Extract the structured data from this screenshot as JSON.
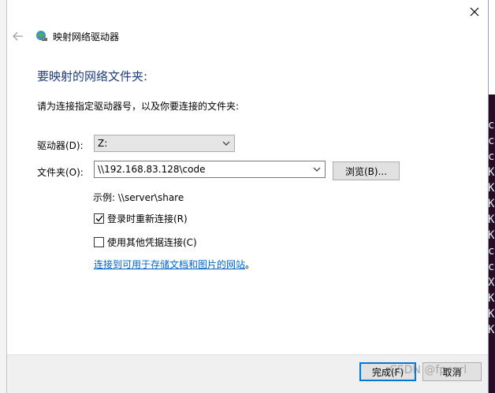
{
  "window": {
    "title": "映射网络驱动器"
  },
  "main": {
    "heading": "要映射的网络文件夹:",
    "instruction": "请为连接指定驱动器号，以及你要连接的文件夹:",
    "drive_label": "驱动器(D):",
    "drive_value": "Z:",
    "folder_label": "文件夹(O):",
    "folder_value": "\\\\192.168.83.128\\code",
    "browse_label": "浏览(B)...",
    "example_text": "示例: \\\\server\\share",
    "reconnect_label": "登录时重新连接(R)",
    "reconnect_checked": true,
    "other_credentials_label": "使用其他凭据连接(C)",
    "other_credentials_checked": false,
    "link_text": "连接到可用于存储文档和图片的网站",
    "link_suffix": "。"
  },
  "footer": {
    "finish_label": "完成(F)",
    "cancel_label": "取消"
  },
  "watermark": "CSDN @fpcarl",
  "background_terminal": [
    "c",
    "c",
    "c",
    "K",
    "K",
    "K",
    "K",
    "K",
    "c",
    "c",
    "X",
    "K",
    "K",
    "K"
  ],
  "colors": {
    "heading": "#1e3d7b",
    "link": "#0066cc",
    "focus": "#0078d7",
    "terminal_bg": "#2b0b22"
  },
  "icons": {
    "close": "close-icon",
    "back": "back-arrow-icon",
    "network_drive": "network-drive-icon",
    "dropdown": "chevron-down-icon",
    "check": "checkmark-icon"
  }
}
